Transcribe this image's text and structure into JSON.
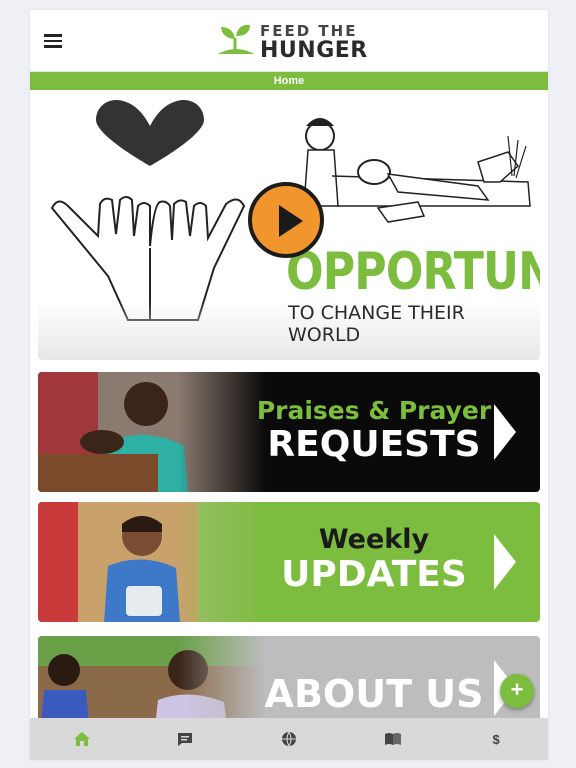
{
  "header": {
    "logo_line1": "FEED THE",
    "logo_line2": "HUNGER",
    "page_label": "Home"
  },
  "hero": {
    "title": "OPPORTUNITY",
    "subtitle": "TO CHANGE THEIR WORLD"
  },
  "banners": [
    {
      "line1": "Praises & Prayer",
      "line2": "REQUESTS"
    },
    {
      "line1": "Weekly",
      "line2": "UPDATES"
    },
    {
      "line2": "ABOUT US"
    }
  ],
  "fab": {
    "label": "+"
  },
  "tabbar": {
    "items": [
      {
        "icon": "home-icon",
        "active": true
      },
      {
        "icon": "chat-icon",
        "active": false
      },
      {
        "icon": "globe-icon",
        "active": false
      },
      {
        "icon": "book-icon",
        "active": false
      },
      {
        "icon": "dollar-icon",
        "label": "$",
        "active": false
      }
    ]
  },
  "colors": {
    "brand_green": "#7cbc3f",
    "play_orange": "#f0962d",
    "dark": "#0a0a0a",
    "tabbar_bg": "#d9d9d9"
  }
}
